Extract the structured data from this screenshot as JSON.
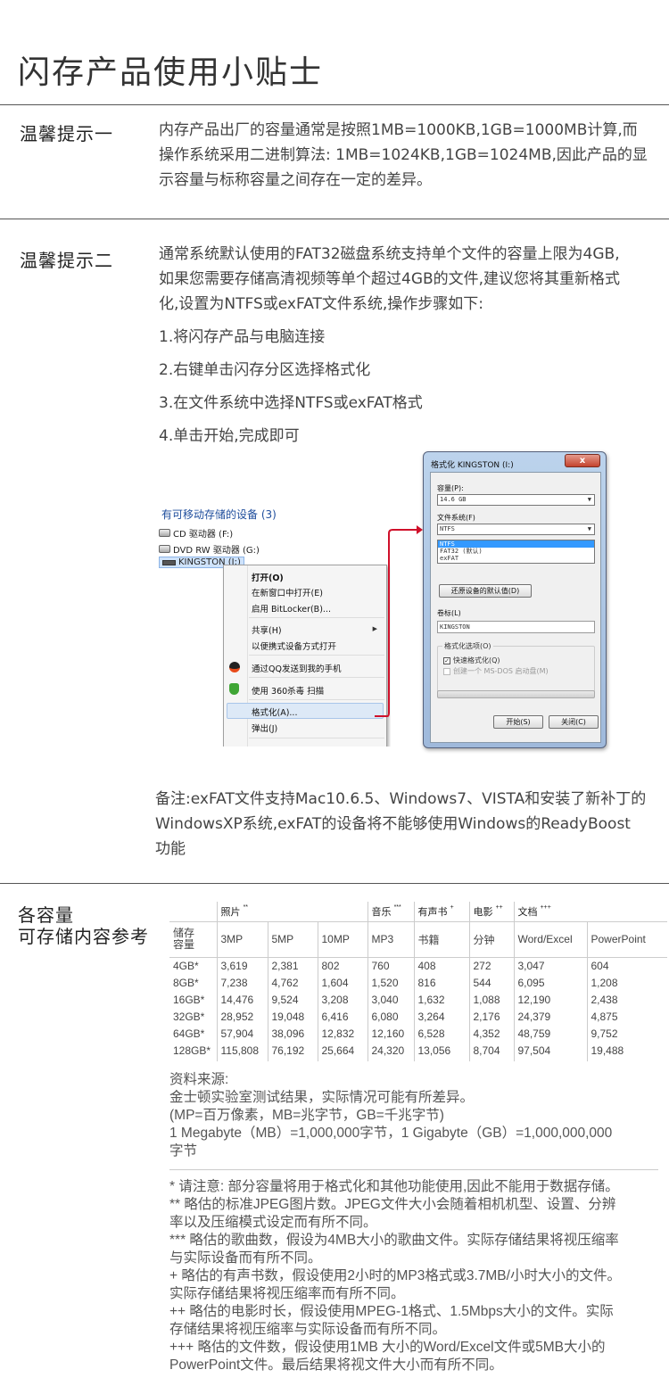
{
  "page_title": "闪存产品使用小贴士",
  "tip1": {
    "label": "温馨提示一",
    "lines": [
      "内存产品出厂的容量通常是按照1MB=1000KB,1GB=1000MB计算,而",
      "操作系统采用二进制算法: 1MB=1024KB,1GB=1024MB,因此产品的显",
      "示容量与标称容量之间存在一定的差异。"
    ]
  },
  "tip2": {
    "label": "温馨提示二",
    "lines": [
      "通常系统默认使用的FAT32磁盘系统支持单个文件的容量上限为4GB,",
      "如果您需要存储高清视频等单个超过4GB的文件,建议您将其重新格式",
      "化,设置为NTFS或exFAT文件系统,操作步骤如下:"
    ],
    "steps": [
      "1.将闪存产品与电脑连接",
      "2.右键单击闪存分区选择格式化",
      "3.在文件系统中选择NTFS或exFAT格式",
      "4.单击开始,完成即可"
    ]
  },
  "explorer": {
    "header": "有可移动存储的设备 (3)",
    "devices": [
      "CD 驱动器 (F:)",
      "DVD RW 驱动器 (G:)",
      "KINGSTON (I:)"
    ],
    "menu": {
      "open": "打开(O)",
      "open_new": "在新窗口中打开(E)",
      "bitlocker": "启用 BitLocker(B)...",
      "share": "共享(H)",
      "portable": "以便携式设备方式打开",
      "qq": "通过QQ发送到我的手机",
      "scan360": "使用 360杀毒 扫描",
      "format": "格式化(A)...",
      "eject": "弹出(J)"
    }
  },
  "format_dialog": {
    "title": "格式化 KINGSTON (I:)",
    "capacity_label": "容量(P):",
    "capacity_value": "14.6 GB",
    "fs_label": "文件系统(F)",
    "fs_value": "NTFS",
    "fs_options": [
      "NTFS",
      "FAT32 (默认)",
      "exFAT"
    ],
    "restore_button": "还原设备的默认值(D)",
    "volume_label": "卷标(L)",
    "volume_value": "KINGSTON",
    "options_label": "格式化选项(O)",
    "quick_format": "快速格式化(Q)",
    "msdos_disk": "创建一个 MS-DOS 启动盘(M)",
    "start_button": "开始(S)",
    "close_button": "关闭(C)",
    "close_x": "x"
  },
  "note": [
    "备注:exFAT文件支持Mac10.6.5、Windows7、VISTA和安装了新补丁的",
    "WindowsXP系统,exFAT的设备将不能够使用Windows的ReadyBoost",
    "功能"
  ],
  "capacity": {
    "label_line1": "各容量",
    "label_line2": "可存储内容参考",
    "groups": {
      "photos": "照片",
      "photos_mark": "**",
      "music": "音乐",
      "music_mark": "***",
      "audiobooks": "有声书",
      "audiobooks_mark": "+",
      "movies": "电影",
      "movies_mark": "++",
      "docs": "文档",
      "docs_mark": "+++"
    },
    "row_header_line1": "储存",
    "row_header_line2": "容量",
    "columns": [
      "3MP",
      "5MP",
      "10MP",
      "MP3",
      "书籍",
      "分钟",
      "Word/Excel",
      "PowerPoint"
    ],
    "rows": [
      [
        "4GB*",
        "3,619",
        "2,381",
        "802",
        "760",
        "408",
        "272",
        "3,047",
        "604"
      ],
      [
        "8GB*",
        "7,238",
        "4,762",
        "1,604",
        "1,520",
        "816",
        "544",
        "6,095",
        "1,208"
      ],
      [
        "16GB*",
        "14,476",
        "9,524",
        "3,208",
        "3,040",
        "1,632",
        "1,088",
        "12,190",
        "2,438"
      ],
      [
        "32GB*",
        "28,952",
        "19,048",
        "6,416",
        "6,080",
        "3,264",
        "2,176",
        "24,379",
        "4,875"
      ],
      [
        "64GB*",
        "57,904",
        "38,096",
        "12,832",
        "12,160",
        "6,528",
        "4,352",
        "48,759",
        "9,752"
      ],
      [
        "128GB*",
        "115,808",
        "76,192",
        "25,664",
        "24,320",
        "13,056",
        "8,704",
        "97,504",
        "19,488"
      ]
    ]
  },
  "source": [
    "资料来源:",
    "金士顿实验室测试结果，实际情况可能有所差异。",
    "(MP=百万像素，MB=兆字节，GB=千兆字节)",
    "1 Megabyte（MB）=1,000,000字节，1 Gigabyte（GB）=1,000,000,000",
    "字节"
  ],
  "footnotes": [
    "* 请注意: 部分容量将用于格式化和其他功能使用,因此不能用于数据存储。",
    "** 略估的标准JPEG图片数。JPEG文件大小会随着相机机型、设置、分辨",
    "率以及压缩模式设定而有所不同。",
    "*** 略估的歌曲数，假设为4MB大小的歌曲文件。实际存储结果将视压缩率",
    "与实际设备而有所不同。",
    "+ 略估的有声书数，假设使用2小时的MP3格式或3.7MB/小时大小的文件。",
    "实际存储结果将视压缩率而有所不同。",
    "++ 略估的电影时长，假设使用MPEG-1格式、1.5Mbps大小的文件。实际",
    "存储结果将视压缩率与实际设备而有所不同。",
    "+++ 略估的文件数，假设使用1MB 大小的Word/Excel文件或5MB大小的",
    "PowerPoint文件。最后结果将视文件大小而有所不同。"
  ],
  "colors": {
    "rule": "#555555",
    "link_blue": "#1e4d9c",
    "arrow_red": "#d0102a",
    "dialog_frame": "#bcd3ec",
    "selection": "#3399ff"
  }
}
